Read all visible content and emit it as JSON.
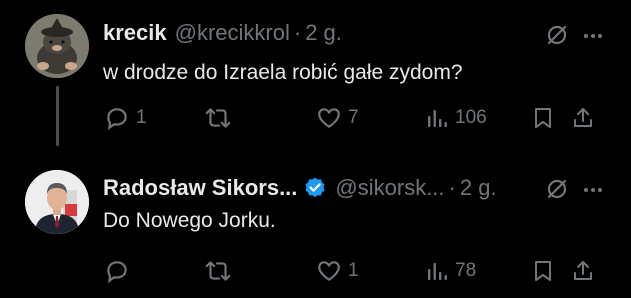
{
  "colors": {
    "background": "#000000",
    "text_primary": "#e7e9ea",
    "text_secondary": "#71767b",
    "verified_badge": "#1d9bf0",
    "thread_line": "#4a4f55"
  },
  "posts": [
    {
      "author_name": "krecik",
      "handle": "@krecikkrol",
      "separator": "·",
      "time": "2 g.",
      "verified": false,
      "text": "w drodze do Izraela robić gałe zydom?",
      "avatar_icon": "mole-cartoon-avatar",
      "actions": {
        "reply_count": "1",
        "retweet_count": "",
        "like_count": "7",
        "views_count": "106"
      }
    },
    {
      "author_name": "Radosław Sikors...",
      "handle": "@sikorsk...",
      "separator": "·",
      "time": "2 g.",
      "verified": true,
      "text": "Do Nowego Jorku.",
      "avatar_icon": "man-portrait-avatar",
      "actions": {
        "reply_count": "",
        "retweet_count": "",
        "like_count": "1",
        "views_count": "78"
      }
    }
  ],
  "icons": {
    "reply": "reply-icon",
    "retweet": "retweet-icon",
    "like": "heart-icon",
    "views": "views-icon",
    "bookmark": "bookmark-icon",
    "share": "share-icon",
    "grok": "grok-icon",
    "more": "more-icon",
    "verified": "verified-badge-icon"
  }
}
